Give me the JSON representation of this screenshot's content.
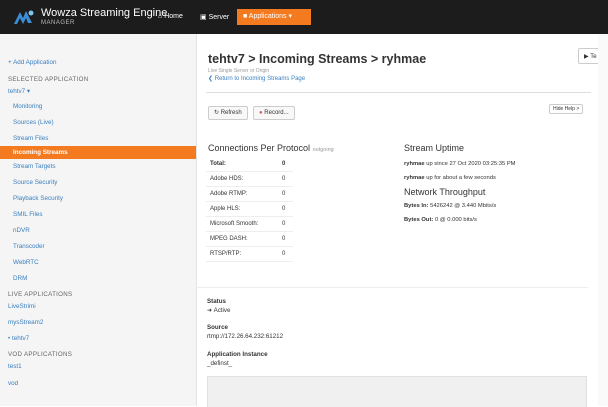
{
  "header": {
    "brand_title": "Wowza Streaming Engine",
    "brand_sub": "MANAGER",
    "nav_home": "Home",
    "nav_server": "Server",
    "nav_applications": "Applications",
    "accent": "#f47a20"
  },
  "sidebar": {
    "add_application": "+ Add Application",
    "selected_heading": "SELECTED APPLICATION",
    "selected_app": "tehtv7",
    "items": [
      {
        "label": "Monitoring"
      },
      {
        "label": "Sources (Live)"
      },
      {
        "label": "Stream Files"
      },
      {
        "label": "Incoming Streams"
      },
      {
        "label": "Stream Targets"
      },
      {
        "label": "Source Security"
      },
      {
        "label": "Playback Security"
      },
      {
        "label": "SMIL Files"
      },
      {
        "label": "nDVR"
      },
      {
        "label": "Transcoder"
      },
      {
        "label": "WebRTC"
      },
      {
        "label": "DRM"
      }
    ],
    "live_heading": "LIVE APPLICATIONS",
    "live_apps": [
      "LiveStrimi",
      "mysStream2",
      "tehtv7"
    ],
    "vod_heading": "VOD APPLICATIONS",
    "vod_apps": [
      "test1",
      "vod"
    ]
  },
  "main": {
    "title": "tehtv7 > Incoming Streams > ryhmae",
    "subtitle": "Live Single Server or Origin",
    "return_link": "Return to Incoming Streams Page",
    "topright_label": "Te",
    "refresh_label": "Refresh",
    "record_label": "Record...",
    "hide_help": "Hide Help >",
    "connections_title": "Connections Per Protocol",
    "connections_muted": "outgoing",
    "protocols": [
      {
        "name": "Total:",
        "value": "0"
      },
      {
        "name": "Adobe HDS:",
        "value": "0"
      },
      {
        "name": "Adobe RTMP:",
        "value": "0"
      },
      {
        "name": "Apple HLS:",
        "value": "0"
      },
      {
        "name": "Microsoft Smooth:",
        "value": "0"
      },
      {
        "name": "MPEG DASH:",
        "value": "0"
      },
      {
        "name": "RTSP/RTP:",
        "value": "0"
      }
    ],
    "uptime_title": "Stream Uptime",
    "uptime_name1": "ryhmae",
    "uptime_since": "up since 27 Oct 2020 03:25:35 PM",
    "uptime_name2": "ryhmae",
    "uptime_for": "up for about a few seconds",
    "throughput_title": "Network Throughput",
    "bytes_in_label": "Bytes In:",
    "bytes_in_value": "5426242  @  3.440 Mbits/s",
    "bytes_out_label": "Bytes Out:",
    "bytes_out_value": "0  @  0.000 bits/s",
    "status_label": "Status",
    "status_value": "Active",
    "source_label": "Source",
    "source_value": "rtmp://172.26.64.232:61212",
    "instance_label": "Application Instance",
    "instance_value": "_definst_"
  }
}
